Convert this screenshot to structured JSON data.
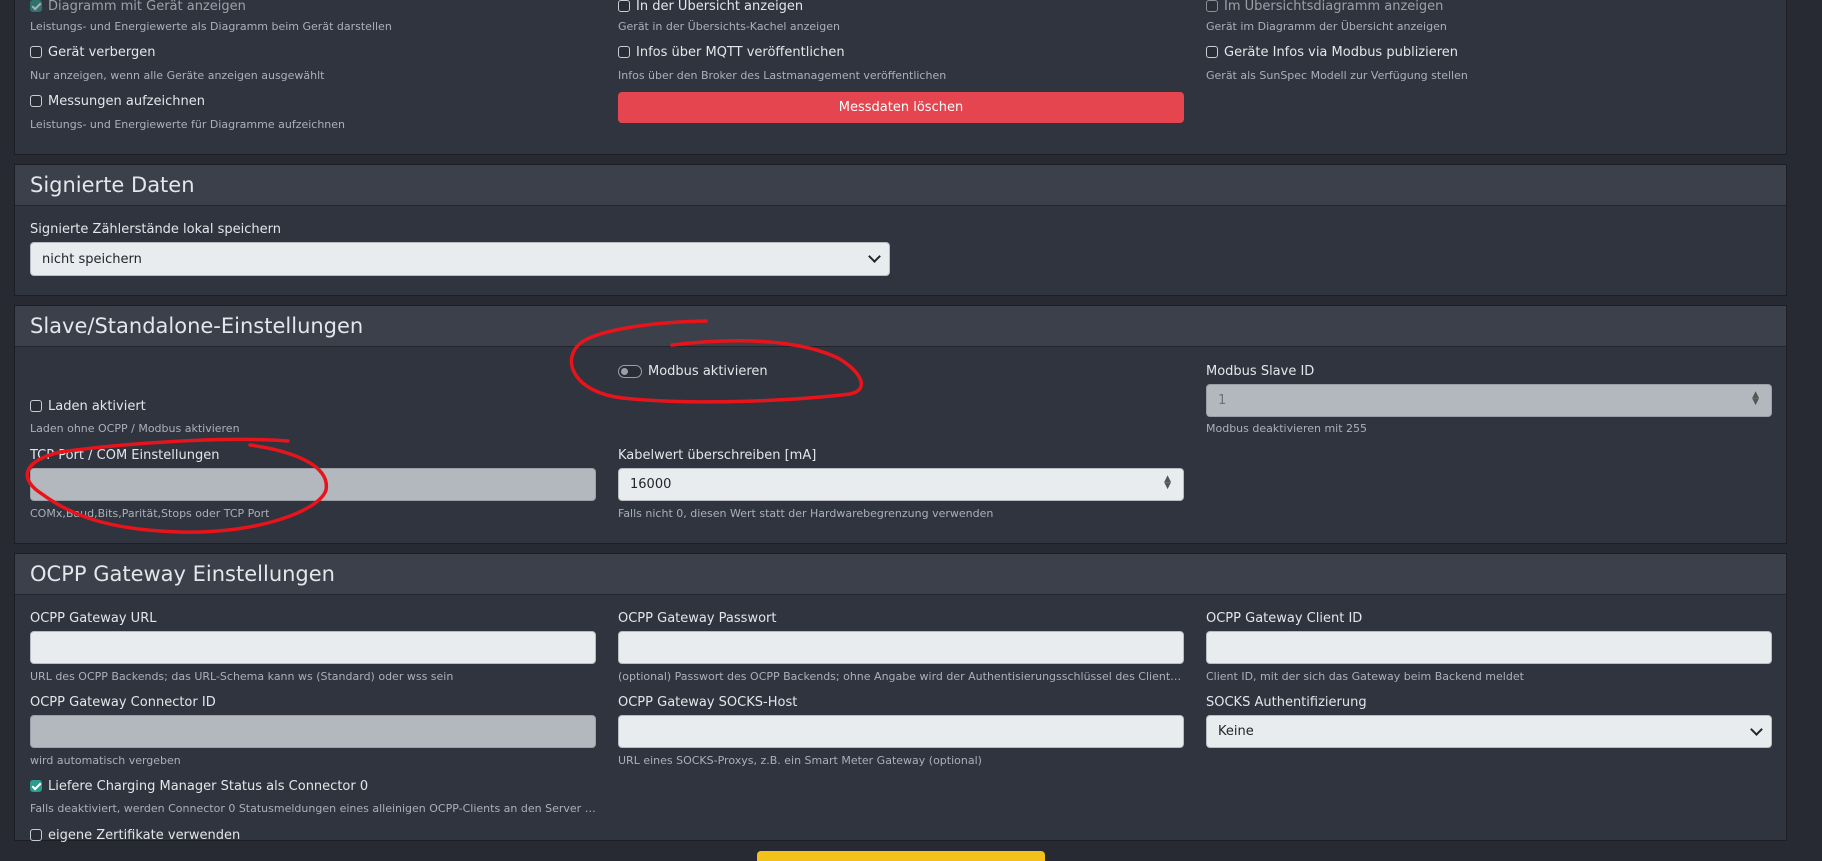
{
  "top_panel": {
    "col1": [
      {
        "label": "Diagramm mit Gerät anzeigen",
        "hint": "Leistungs- und Energiewerte als Diagramm beim Gerät darstellen",
        "checked": true
      },
      {
        "label": "Gerät verbergen",
        "hint": "Nur anzeigen, wenn alle Geräte anzeigen ausgewählt",
        "checked": false
      },
      {
        "label": "Messungen aufzeichnen",
        "hint": "Leistungs- und Energiewerte für Diagramme aufzeichnen",
        "checked": false
      }
    ],
    "col2": [
      {
        "label": "In der Übersicht anzeigen",
        "hint": "Gerät in der Übersichts-Kachel anzeigen",
        "checked": false
      },
      {
        "label": "Infos über MQTT veröffentlichen",
        "hint": "Infos über den Broker des Lastmanagement veröffentlichen",
        "checked": false
      }
    ],
    "delete_button": "Messdaten löschen",
    "col3": [
      {
        "label": "Im Übersichtsdiagramm anzeigen",
        "hint": "Gerät im Diagramm der Übersicht anzeigen",
        "checked": false
      },
      {
        "label": "Geräte Infos via Modbus publizieren",
        "hint": "Gerät als SunSpec Modell zur Verfügung stellen",
        "checked": false
      }
    ]
  },
  "signed_data": {
    "title": "Signierte Daten",
    "field_label": "Signierte Zählerstände lokal speichern",
    "selected": "nicht speichern"
  },
  "slave": {
    "title": "Slave/Standalone-Einstellungen",
    "modbus_toggle_label": "Modbus aktivieren",
    "modbus_slave_id_label": "Modbus Slave ID",
    "modbus_slave_id_value": "1",
    "modbus_slave_id_hint": "Modbus deaktivieren mit 255",
    "charging_label": "Laden aktiviert",
    "charging_hint": "Laden ohne OCPP / Modbus aktivieren",
    "tcp_label": "TCP Port / COM Einstellungen",
    "tcp_value": "",
    "tcp_hint": "COMx,Baud,Bits,Parität,Stops oder TCP Port",
    "cable_label": "Kabelwert überschreiben [mA]",
    "cable_value": "16000",
    "cable_hint": "Falls nicht 0, diesen Wert statt der Hardwarebegrenzung verwenden"
  },
  "ocpp": {
    "title": "OCPP Gateway Einstellungen",
    "url_label": "OCPP Gateway URL",
    "url_value": "",
    "url_hint": "URL des OCPP Backends; das URL-Schema kann ws (Standard) oder wss sein",
    "password_label": "OCPP Gateway Passwort",
    "password_value": "",
    "password_hint": "(optional) Passwort des OCPP Backends; ohne Angabe wird der Authentisierungsschlüssel des Clients übe…",
    "client_id_label": "OCPP Gateway Client ID",
    "client_id_value": "",
    "client_id_hint": "Client ID, mit der sich das Gateway beim Backend meldet",
    "connector_label": "OCPP Gateway Connector ID",
    "connector_value": "",
    "connector_hint": "wird automatisch vergeben",
    "socks_host_label": "OCPP Gateway SOCKS-Host",
    "socks_host_value": "",
    "socks_host_hint": "URL eines SOCKS-Proxys, z.B. ein Smart Meter Gateway (optional)",
    "socks_auth_label": "SOCKS Authentifizierung",
    "socks_auth_selected": "Keine",
    "cm_status_label": "Liefere Charging Manager Status als Connector 0",
    "cm_status_hint": "Falls deaktiviert, werden Connector 0 Statusmeldungen eines alleinigen OCPP-Clients an den Server durc…",
    "own_certs_label": "eigene Zertifikate verwenden"
  },
  "annotation_color": "#e8141c",
  "save_button_color": "#f2c21b"
}
